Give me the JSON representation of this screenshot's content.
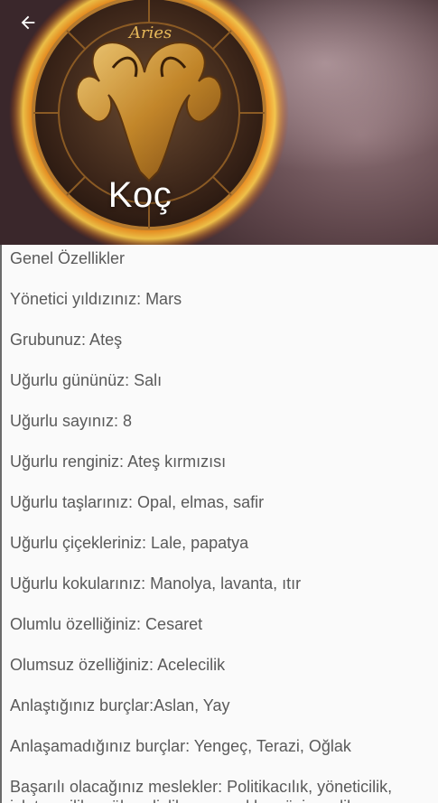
{
  "header": {
    "title": "Koç",
    "emblem_text": "Aries",
    "back_icon": "arrow-left-icon"
  },
  "colors": {
    "title_text": "#ffffff",
    "body_text": "#5a5a5a",
    "background": "#fafafa"
  },
  "content": {
    "heading": "Genel Özellikler",
    "lines": [
      "Yönetici yıldızınız: Mars",
      "Grubunuz: Ateş",
      "Uğurlu gününüz: Salı",
      "Uğurlu sayınız: 8",
      "Uğurlu renginiz: Ateş kırmızısı",
      "Uğurlu taşlarınız: Opal, elmas, safir",
      "Uğurlu çiçekleriniz: Lale, papatya",
      "Uğurlu kokularınız: Manolya, lavanta, ıtır",
      "Olumlu özelliğiniz: Cesaret",
      "Olumsuz özelliğiniz: Acelecilik",
      "Anlaştığınız burçlar:Aslan, Yay",
      "Anlaşamadığınız burçlar: Yengeç, Terazi, Oğlak",
      "Başarılı olacağınız meslekler: Politikacılık, yöneticilik, işletmecilik, mühendislik, ressamlık, müzisyenlik"
    ]
  }
}
